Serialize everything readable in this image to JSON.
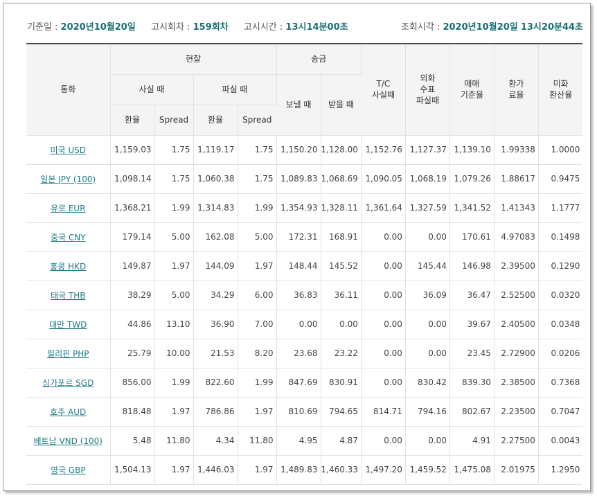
{
  "info": {
    "base_date_label": "기준일 :",
    "base_date": "2020년10월20일",
    "round_label": "고시회차 :",
    "round": "159회차",
    "time_label": "고시시간 :",
    "time": "13시14분00초",
    "query_label": "조회시각 :",
    "query_date": "2020년10월20일",
    "query_time": "13시20분44초"
  },
  "headers": {
    "currency": "통화",
    "cash": "현찰",
    "buy": "사실 때",
    "sell": "파실 때",
    "remit": "송금",
    "send": "보낼 때",
    "receive": "받을 때",
    "tc_line1": "T/C",
    "tc_line2": "사실때",
    "check_line1": "외화",
    "check_line2": "수표",
    "check_line3": "파실때",
    "base_line1": "매매",
    "base_line2": "기준율",
    "conv_line1": "환가",
    "conv_line2": "료율",
    "usd_line1": "미화",
    "usd_line2": "환산율",
    "rate": "환율",
    "spread": "Spread"
  },
  "rows": [
    {
      "currency": "미국 USD",
      "cash_buy": "1,159.03",
      "cash_buy_spread": "1.75",
      "cash_sell": "1,119.17",
      "cash_sell_spread": "1.75",
      "send": "1,150.20",
      "receive": "1,128.00",
      "tc": "1,152.76",
      "check": "1,127.37",
      "base": "1,139.10",
      "conv": "1.99338",
      "usd": "1.0000"
    },
    {
      "currency": "일본 JPY (100)",
      "cash_buy": "1,098.14",
      "cash_buy_spread": "1.75",
      "cash_sell": "1,060.38",
      "cash_sell_spread": "1.75",
      "send": "1,089.83",
      "receive": "1,068.69",
      "tc": "1,090.05",
      "check": "1,068.19",
      "base": "1,079.26",
      "conv": "1.88617",
      "usd": "0.9475"
    },
    {
      "currency": "유로 EUR",
      "cash_buy": "1,368.21",
      "cash_buy_spread": "1.99",
      "cash_sell": "1,314.83",
      "cash_sell_spread": "1.99",
      "send": "1,354.93",
      "receive": "1,328.11",
      "tc": "1,361.64",
      "check": "1,327.59",
      "base": "1,341.52",
      "conv": "1.41343",
      "usd": "1.1777"
    },
    {
      "currency": "중국 CNY",
      "cash_buy": "179.14",
      "cash_buy_spread": "5.00",
      "cash_sell": "162.08",
      "cash_sell_spread": "5.00",
      "send": "172.31",
      "receive": "168.91",
      "tc": "0.00",
      "check": "0.00",
      "base": "170.61",
      "conv": "4.97083",
      "usd": "0.1498"
    },
    {
      "currency": "홍콩 HKD",
      "cash_buy": "149.87",
      "cash_buy_spread": "1.97",
      "cash_sell": "144.09",
      "cash_sell_spread": "1.97",
      "send": "148.44",
      "receive": "145.52",
      "tc": "0.00",
      "check": "145.44",
      "base": "146.98",
      "conv": "2.39500",
      "usd": "0.1290"
    },
    {
      "currency": "태국 THB",
      "cash_buy": "38.29",
      "cash_buy_spread": "5.00",
      "cash_sell": "34.29",
      "cash_sell_spread": "6.00",
      "send": "36.83",
      "receive": "36.11",
      "tc": "0.00",
      "check": "36.09",
      "base": "36.47",
      "conv": "2.52500",
      "usd": "0.0320"
    },
    {
      "currency": "대만 TWD",
      "cash_buy": "44.86",
      "cash_buy_spread": "13.10",
      "cash_sell": "36.90",
      "cash_sell_spread": "7.00",
      "send": "0.00",
      "receive": "0.00",
      "tc": "0.00",
      "check": "0.00",
      "base": "39.67",
      "conv": "2.40500",
      "usd": "0.0348"
    },
    {
      "currency": "필리핀 PHP",
      "cash_buy": "25.79",
      "cash_buy_spread": "10.00",
      "cash_sell": "21.53",
      "cash_sell_spread": "8.20",
      "send": "23.68",
      "receive": "23.22",
      "tc": "0.00",
      "check": "0.00",
      "base": "23.45",
      "conv": "2.72900",
      "usd": "0.0206"
    },
    {
      "currency": "싱가포르 SGD",
      "cash_buy": "856.00",
      "cash_buy_spread": "1.99",
      "cash_sell": "822.60",
      "cash_sell_spread": "1.99",
      "send": "847.69",
      "receive": "830.91",
      "tc": "0.00",
      "check": "830.42",
      "base": "839.30",
      "conv": "2.38500",
      "usd": "0.7368"
    },
    {
      "currency": "호주 AUD",
      "cash_buy": "818.48",
      "cash_buy_spread": "1.97",
      "cash_sell": "786.86",
      "cash_sell_spread": "1.97",
      "send": "810.69",
      "receive": "794.65",
      "tc": "814.71",
      "check": "794.16",
      "base": "802.67",
      "conv": "2.23500",
      "usd": "0.7047"
    },
    {
      "currency": "베트남 VND (100)",
      "cash_buy": "5.48",
      "cash_buy_spread": "11.80",
      "cash_sell": "4.34",
      "cash_sell_spread": "11.80",
      "send": "4.95",
      "receive": "4.87",
      "tc": "0.00",
      "check": "0.00",
      "base": "4.91",
      "conv": "2.27500",
      "usd": "0.0043"
    },
    {
      "currency": "영국 GBP",
      "cash_buy": "1,504.13",
      "cash_buy_spread": "1.97",
      "cash_sell": "1,446.03",
      "cash_sell_spread": "1.97",
      "send": "1,489.83",
      "receive": "1,460.33",
      "tc": "1,497.20",
      "check": "1,459.52",
      "base": "1,475.08",
      "conv": "2.01975",
      "usd": "1.2950"
    }
  ]
}
